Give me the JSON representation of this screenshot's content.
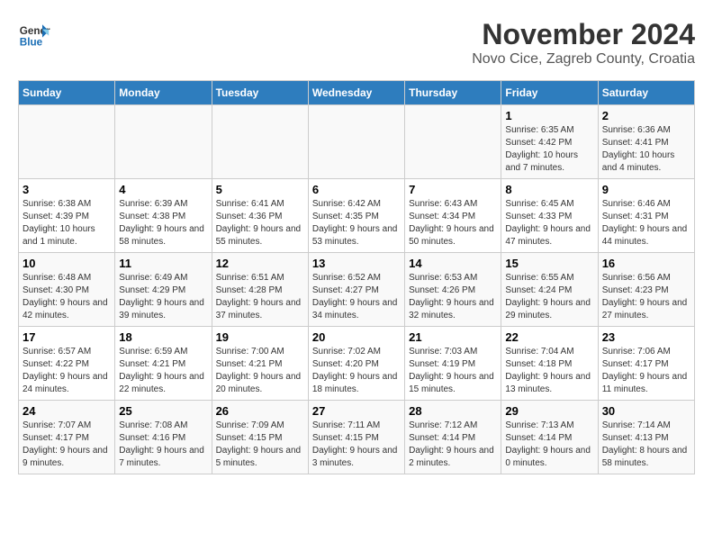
{
  "header": {
    "logo_line1": "General",
    "logo_line2": "Blue",
    "month_title": "November 2024",
    "location": "Novo Cice, Zagreb County, Croatia"
  },
  "days_of_week": [
    "Sunday",
    "Monday",
    "Tuesday",
    "Wednesday",
    "Thursday",
    "Friday",
    "Saturday"
  ],
  "weeks": [
    [
      {
        "day": "",
        "info": ""
      },
      {
        "day": "",
        "info": ""
      },
      {
        "day": "",
        "info": ""
      },
      {
        "day": "",
        "info": ""
      },
      {
        "day": "",
        "info": ""
      },
      {
        "day": "1",
        "info": "Sunrise: 6:35 AM\nSunset: 4:42 PM\nDaylight: 10 hours and 7 minutes."
      },
      {
        "day": "2",
        "info": "Sunrise: 6:36 AM\nSunset: 4:41 PM\nDaylight: 10 hours and 4 minutes."
      }
    ],
    [
      {
        "day": "3",
        "info": "Sunrise: 6:38 AM\nSunset: 4:39 PM\nDaylight: 10 hours and 1 minute."
      },
      {
        "day": "4",
        "info": "Sunrise: 6:39 AM\nSunset: 4:38 PM\nDaylight: 9 hours and 58 minutes."
      },
      {
        "day": "5",
        "info": "Sunrise: 6:41 AM\nSunset: 4:36 PM\nDaylight: 9 hours and 55 minutes."
      },
      {
        "day": "6",
        "info": "Sunrise: 6:42 AM\nSunset: 4:35 PM\nDaylight: 9 hours and 53 minutes."
      },
      {
        "day": "7",
        "info": "Sunrise: 6:43 AM\nSunset: 4:34 PM\nDaylight: 9 hours and 50 minutes."
      },
      {
        "day": "8",
        "info": "Sunrise: 6:45 AM\nSunset: 4:33 PM\nDaylight: 9 hours and 47 minutes."
      },
      {
        "day": "9",
        "info": "Sunrise: 6:46 AM\nSunset: 4:31 PM\nDaylight: 9 hours and 44 minutes."
      }
    ],
    [
      {
        "day": "10",
        "info": "Sunrise: 6:48 AM\nSunset: 4:30 PM\nDaylight: 9 hours and 42 minutes."
      },
      {
        "day": "11",
        "info": "Sunrise: 6:49 AM\nSunset: 4:29 PM\nDaylight: 9 hours and 39 minutes."
      },
      {
        "day": "12",
        "info": "Sunrise: 6:51 AM\nSunset: 4:28 PM\nDaylight: 9 hours and 37 minutes."
      },
      {
        "day": "13",
        "info": "Sunrise: 6:52 AM\nSunset: 4:27 PM\nDaylight: 9 hours and 34 minutes."
      },
      {
        "day": "14",
        "info": "Sunrise: 6:53 AM\nSunset: 4:26 PM\nDaylight: 9 hours and 32 minutes."
      },
      {
        "day": "15",
        "info": "Sunrise: 6:55 AM\nSunset: 4:24 PM\nDaylight: 9 hours and 29 minutes."
      },
      {
        "day": "16",
        "info": "Sunrise: 6:56 AM\nSunset: 4:23 PM\nDaylight: 9 hours and 27 minutes."
      }
    ],
    [
      {
        "day": "17",
        "info": "Sunrise: 6:57 AM\nSunset: 4:22 PM\nDaylight: 9 hours and 24 minutes."
      },
      {
        "day": "18",
        "info": "Sunrise: 6:59 AM\nSunset: 4:21 PM\nDaylight: 9 hours and 22 minutes."
      },
      {
        "day": "19",
        "info": "Sunrise: 7:00 AM\nSunset: 4:21 PM\nDaylight: 9 hours and 20 minutes."
      },
      {
        "day": "20",
        "info": "Sunrise: 7:02 AM\nSunset: 4:20 PM\nDaylight: 9 hours and 18 minutes."
      },
      {
        "day": "21",
        "info": "Sunrise: 7:03 AM\nSunset: 4:19 PM\nDaylight: 9 hours and 15 minutes."
      },
      {
        "day": "22",
        "info": "Sunrise: 7:04 AM\nSunset: 4:18 PM\nDaylight: 9 hours and 13 minutes."
      },
      {
        "day": "23",
        "info": "Sunrise: 7:06 AM\nSunset: 4:17 PM\nDaylight: 9 hours and 11 minutes."
      }
    ],
    [
      {
        "day": "24",
        "info": "Sunrise: 7:07 AM\nSunset: 4:17 PM\nDaylight: 9 hours and 9 minutes."
      },
      {
        "day": "25",
        "info": "Sunrise: 7:08 AM\nSunset: 4:16 PM\nDaylight: 9 hours and 7 minutes."
      },
      {
        "day": "26",
        "info": "Sunrise: 7:09 AM\nSunset: 4:15 PM\nDaylight: 9 hours and 5 minutes."
      },
      {
        "day": "27",
        "info": "Sunrise: 7:11 AM\nSunset: 4:15 PM\nDaylight: 9 hours and 3 minutes."
      },
      {
        "day": "28",
        "info": "Sunrise: 7:12 AM\nSunset: 4:14 PM\nDaylight: 9 hours and 2 minutes."
      },
      {
        "day": "29",
        "info": "Sunrise: 7:13 AM\nSunset: 4:14 PM\nDaylight: 9 hours and 0 minutes."
      },
      {
        "day": "30",
        "info": "Sunrise: 7:14 AM\nSunset: 4:13 PM\nDaylight: 8 hours and 58 minutes."
      }
    ]
  ]
}
